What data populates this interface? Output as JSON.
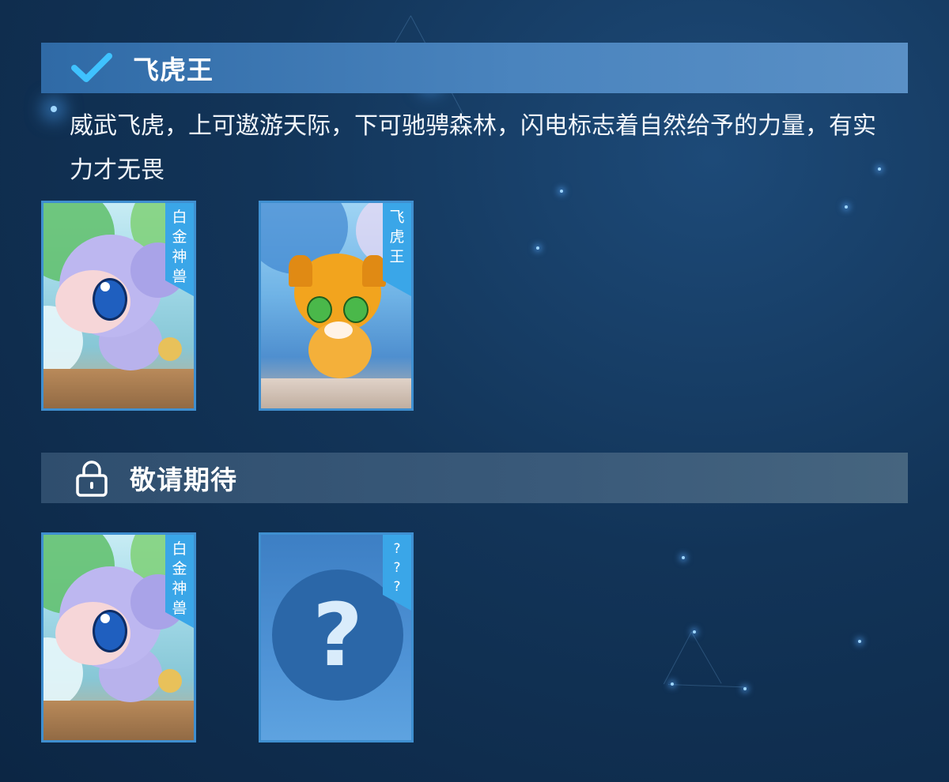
{
  "section_unlocked": {
    "title": "飞虎王",
    "status_icon": "checkmark-icon",
    "description": "威武飞虎，上可遨游天际，下可驰骋森林，闪电标志着自然给予的力量，有实力才无畏",
    "cards": [
      {
        "ribbon": [
          "白",
          "金",
          "神",
          "兽"
        ],
        "art": "lavender-pet-card-art"
      },
      {
        "ribbon": [
          "飞",
          "虎",
          "王"
        ],
        "art": "orange-tiger-pet-card-art"
      }
    ]
  },
  "section_locked": {
    "title": "敬请期待",
    "status_icon": "lock-icon",
    "cards": [
      {
        "ribbon": [
          "白",
          "金",
          "神",
          "兽"
        ],
        "art": "lavender-pet-card-art"
      },
      {
        "ribbon": [
          "?",
          "?",
          "?"
        ],
        "art": "question-mark-icon"
      }
    ]
  },
  "colors": {
    "background": "#123458",
    "unlocked_bar": "#4a84be",
    "locked_bar": "#3a5a7a",
    "ribbon": "#3aa6e8",
    "check": "#3fc2ff",
    "card_border": "#3f8fd0"
  }
}
